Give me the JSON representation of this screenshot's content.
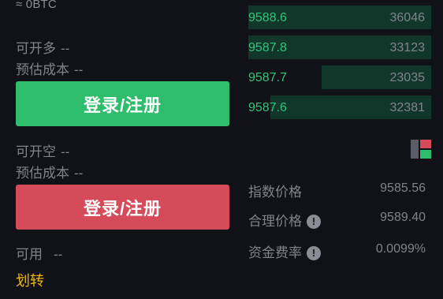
{
  "account": {
    "balance_text": "≈ 0BTC"
  },
  "long": {
    "available_label": "可开多",
    "available_value": "--",
    "est_cost_label": "预估成本",
    "est_cost_value": "--",
    "button_label": "登录/注册"
  },
  "short": {
    "available_label": "可开空",
    "available_value": "--",
    "est_cost_label": "预估成本",
    "est_cost_value": "--",
    "button_label": "登录/注册"
  },
  "available": {
    "label": "可用",
    "value": "--"
  },
  "transfer_label": "划转",
  "order_book": {
    "bids": [
      {
        "price": "9588.6",
        "qty": "36046",
        "depth": 1.0
      },
      {
        "price": "9587.8",
        "qty": "33123",
        "depth": 1.0
      },
      {
        "price": "9587.7",
        "qty": "23035",
        "depth": 0.6
      },
      {
        "price": "9587.6",
        "qty": "32381",
        "depth": 0.88
      }
    ]
  },
  "stats": {
    "index_price_label": "指数价格",
    "index_price_value": "9585.56",
    "fair_price_label": "合理价格",
    "fair_price_value": "9589.40",
    "funding_rate_label": "资金费率",
    "funding_rate_value": "0.0099%"
  },
  "icons": {
    "info": "info-circle-icon",
    "layout_toggle": "book-layout-toggle-icon"
  },
  "colors": {
    "background": "#111217",
    "buy_green": "#2ebd6b",
    "sell_red": "#d64b59",
    "bid_text": "#30c57a",
    "bid_depth": "#11362a",
    "accent_yellow": "#f0b90b",
    "muted_text": "#80838c"
  }
}
